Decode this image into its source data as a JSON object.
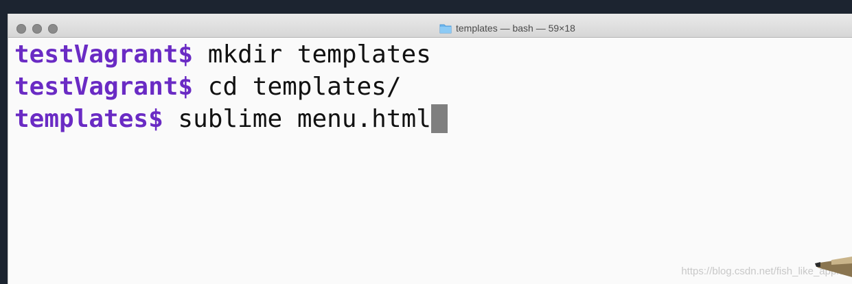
{
  "window": {
    "title": "templates — bash — 59×18"
  },
  "icons": {
    "folder": "folder-icon",
    "traffic_lights": [
      "close-icon",
      "minimize-icon",
      "zoom-icon"
    ],
    "pen": "pen-icon"
  },
  "terminal": {
    "lines": [
      {
        "prompt": "testVagrant$",
        "command": " mkdir templates"
      },
      {
        "prompt": "testVagrant$",
        "command": " cd templates/"
      },
      {
        "prompt": "templates$",
        "command": " sublime menu.html"
      }
    ]
  },
  "watermark": "https://blog.csdn.net/fish_like_apple",
  "colors": {
    "prompt": "#6a2bc4",
    "background": "#fafafa",
    "titlebar": "#dcdcdc",
    "cursor": "#7f7f7f"
  }
}
